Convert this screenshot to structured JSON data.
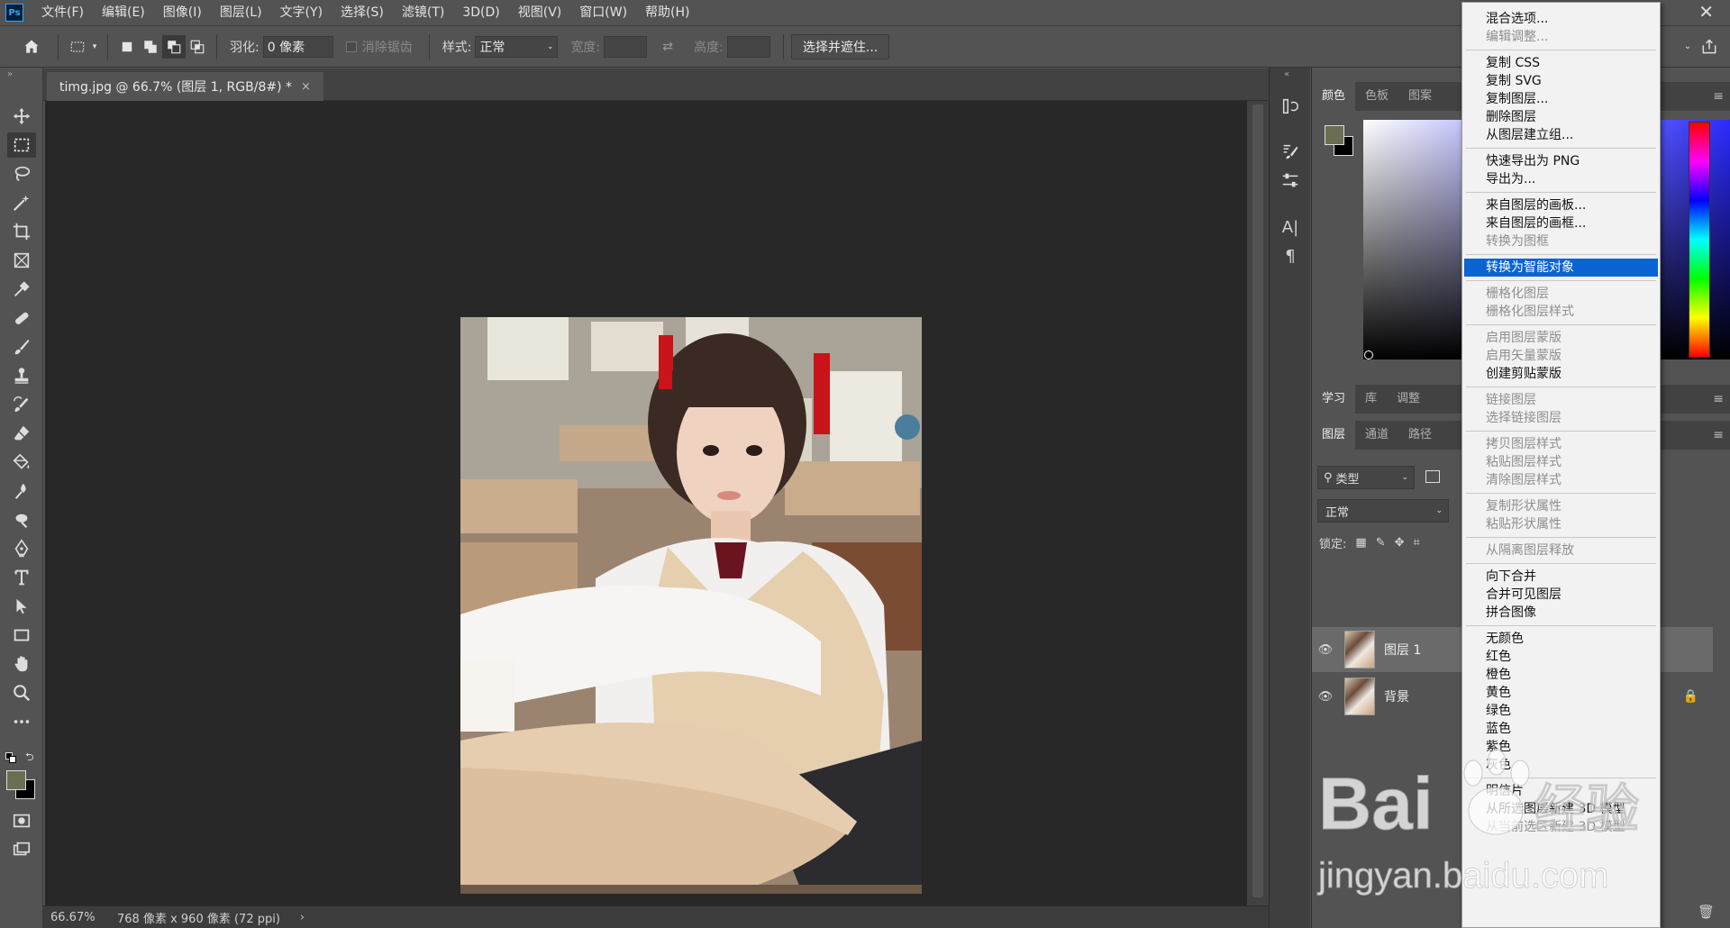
{
  "app": {
    "logo": "Ps"
  },
  "menubar": {
    "items": [
      "文件(F)",
      "编辑(E)",
      "图像(I)",
      "图层(L)",
      "文字(Y)",
      "选择(S)",
      "滤镜(T)",
      "3D(D)",
      "视图(V)",
      "窗口(W)",
      "帮助(H)"
    ],
    "close_glyph": "✕"
  },
  "options": {
    "feather_label": "羽化:",
    "feather_value": "0 像素",
    "antialias_label": "消除锯齿",
    "style_label": "样式:",
    "style_value": "正常",
    "width_label": "宽度:",
    "height_label": "高度:",
    "select_mask_button": "选择并遮住..."
  },
  "document": {
    "tab_title": "timg.jpg @ 66.7% (图层 1, RGB/8#) *",
    "tab_close": "×"
  },
  "status": {
    "zoom": "66.67%",
    "info": "768 像素 x 960 像素 (72 ppi)",
    "arrow": "›"
  },
  "panels": {
    "color_tabs": [
      "颜色",
      "色板",
      "图案"
    ],
    "learn_tabs": [
      "学习",
      "库",
      "调整"
    ],
    "layer_tabs": [
      "图层",
      "通道",
      "路径"
    ],
    "filter_kind": "类型",
    "blend_mode": "正常",
    "lock_label": "锁定:",
    "layers": [
      {
        "name": "图层 1",
        "selected": true,
        "visible": true,
        "locked": false
      },
      {
        "name": "背景",
        "selected": false,
        "visible": true,
        "locked": true
      }
    ],
    "foreground_color": "#6b6e53",
    "background_color": "#000000"
  },
  "context_menu": {
    "items": [
      {
        "label": "混合选项...",
        "disabled": false
      },
      {
        "label": "编辑调整...",
        "disabled": true
      },
      {
        "sep": true
      },
      {
        "label": "复制 CSS",
        "disabled": false
      },
      {
        "label": "复制 SVG",
        "disabled": false
      },
      {
        "label": "复制图层...",
        "disabled": false
      },
      {
        "label": "删除图层",
        "disabled": false
      },
      {
        "label": "从图层建立组...",
        "disabled": false
      },
      {
        "sep": true
      },
      {
        "label": "快速导出为 PNG",
        "disabled": false
      },
      {
        "label": "导出为...",
        "disabled": false
      },
      {
        "sep": true
      },
      {
        "label": "来自图层的画板...",
        "disabled": false
      },
      {
        "label": "来自图层的画框...",
        "disabled": false
      },
      {
        "label": "转换为图框",
        "disabled": true
      },
      {
        "sep": true
      },
      {
        "label": "转换为智能对象",
        "disabled": false,
        "highlight": true
      },
      {
        "sep": true
      },
      {
        "label": "栅格化图层",
        "disabled": true
      },
      {
        "label": "栅格化图层样式",
        "disabled": true
      },
      {
        "sep": true
      },
      {
        "label": "启用图层蒙版",
        "disabled": true
      },
      {
        "label": "启用矢量蒙版",
        "disabled": true
      },
      {
        "label": "创建剪贴蒙版",
        "disabled": false
      },
      {
        "sep": true
      },
      {
        "label": "链接图层",
        "disabled": true
      },
      {
        "label": "选择链接图层",
        "disabled": true
      },
      {
        "sep": true
      },
      {
        "label": "拷贝图层样式",
        "disabled": true
      },
      {
        "label": "粘贴图层样式",
        "disabled": true
      },
      {
        "label": "清除图层样式",
        "disabled": true
      },
      {
        "sep": true
      },
      {
        "label": "复制形状属性",
        "disabled": true
      },
      {
        "label": "粘贴形状属性",
        "disabled": true
      },
      {
        "sep": true
      },
      {
        "label": "从隔离图层释放",
        "disabled": true
      },
      {
        "sep": true
      },
      {
        "label": "向下合并",
        "disabled": false
      },
      {
        "label": "合并可见图层",
        "disabled": false
      },
      {
        "label": "拼合图像",
        "disabled": false
      },
      {
        "sep": true
      },
      {
        "label": "无颜色",
        "disabled": false
      },
      {
        "label": "红色",
        "disabled": false
      },
      {
        "label": "橙色",
        "disabled": false
      },
      {
        "label": "黄色",
        "disabled": false
      },
      {
        "label": "绿色",
        "disabled": false
      },
      {
        "label": "蓝色",
        "disabled": false
      },
      {
        "label": "紫色",
        "disabled": false
      },
      {
        "label": "灰色",
        "disabled": false
      },
      {
        "sep": true
      },
      {
        "label": "明信片",
        "disabled": false
      },
      {
        "label": "从所选图层新建 3D 模型",
        "disabled": false
      },
      {
        "label": "从当前选区新建 3D 模型",
        "disabled": true
      }
    ]
  },
  "watermark": {
    "brand": "Bai",
    "brand_cn": "经验",
    "url": "jingyan.baidu.com"
  }
}
